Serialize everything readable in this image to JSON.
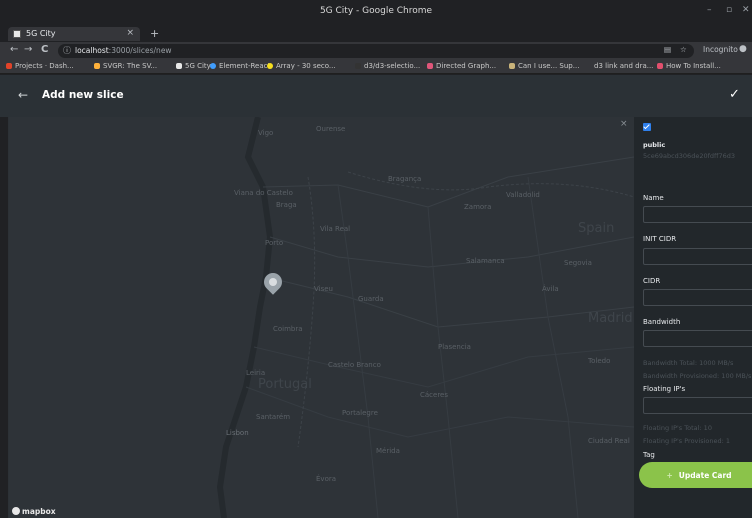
{
  "window": {
    "title": "5G City - Google Chrome",
    "controls": [
      "–",
      "▫",
      "✕"
    ]
  },
  "tab": {
    "title": "5G City",
    "close": "×",
    "new_tab": "+"
  },
  "toolbar": {
    "back": "←",
    "forward": "→",
    "reload": "C",
    "url_host": "localhost",
    "url_path": ":3000/slices/new",
    "incognito_label": "Incognito"
  },
  "bookmarks": [
    {
      "label": "Projects · Dash...",
      "color": "#e24329"
    },
    {
      "label": "SVGR: The SV...",
      "color": "#ffb13b"
    },
    {
      "label": "5G City",
      "color": "#e8e8e8"
    },
    {
      "label": "Element-React",
      "color": "#409eff"
    },
    {
      "label": "Array - 30 seco...",
      "color": "#f7df1e"
    },
    {
      "label": "d3/d3-selectio...",
      "color": "#333333"
    },
    {
      "label": "Directed Graph...",
      "color": "#e0567a"
    },
    {
      "label": "Can I use... Sup...",
      "color": "#c9b37a"
    },
    {
      "label": "d3 link and dra...",
      "color": "#35363a"
    },
    {
      "label": "How To Install...",
      "color": "#e24f6d"
    }
  ],
  "appbar": {
    "back": "←",
    "title": "Add new slice",
    "confirm": "✓"
  },
  "map": {
    "close": "×",
    "attribution": "mapbox",
    "labels": [
      {
        "text": "Vigo",
        "cls": ""
      },
      {
        "text": "Ourense",
        "cls": ""
      },
      {
        "text": "Braga",
        "cls": ""
      },
      {
        "text": "Viana do Castelo",
        "cls": ""
      },
      {
        "text": "Bragança",
        "cls": ""
      },
      {
        "text": "Valladolid",
        "cls": ""
      },
      {
        "text": "Zamora",
        "cls": ""
      },
      {
        "text": "Porto",
        "cls": ""
      },
      {
        "text": "Vila Real",
        "cls": ""
      },
      {
        "text": "Spain",
        "cls": "big"
      },
      {
        "text": "Salamanca",
        "cls": ""
      },
      {
        "text": "Segovia",
        "cls": ""
      },
      {
        "text": "Viseu",
        "cls": ""
      },
      {
        "text": "Guarda",
        "cls": ""
      },
      {
        "text": "Ávila",
        "cls": ""
      },
      {
        "text": "Madrid",
        "cls": "big"
      },
      {
        "text": "Coimbra",
        "cls": ""
      },
      {
        "text": "Plasencia",
        "cls": ""
      },
      {
        "text": "Leiria",
        "cls": ""
      },
      {
        "text": "Castelo Branco",
        "cls": ""
      },
      {
        "text": "Portugal",
        "cls": "big"
      },
      {
        "text": "Toledo",
        "cls": ""
      },
      {
        "text": "Cáceres",
        "cls": ""
      },
      {
        "text": "Santarém",
        "cls": ""
      },
      {
        "text": "Portalegre",
        "cls": ""
      },
      {
        "text": "Ciudad Real",
        "cls": ""
      },
      {
        "text": "Lisbon",
        "cls": ""
      },
      {
        "text": "Mérida",
        "cls": ""
      },
      {
        "text": "Évora",
        "cls": ""
      }
    ]
  },
  "panel": {
    "public_label": "public",
    "id_value": "5ce69abcd306de20fdff76d3",
    "name_label": "Name",
    "init_cidr_label": "INIT CIDR",
    "cidr_label": "CIDR",
    "bandwidth_label": "Bandwidth",
    "bandwidth_total": "Bandwidth Total: 1000 MB/s",
    "bandwidth_provisioned": "Bandwidth Provisioned: 100 MB/s",
    "floating_ips_label": "Floating IP's",
    "floating_ips_total": "Floating IP's Total: 10",
    "floating_ips_provisioned": "Floating IP's Provisioned: 1",
    "tag_label": "Tag",
    "update_button": "Update Card",
    "update_icon": "+"
  }
}
